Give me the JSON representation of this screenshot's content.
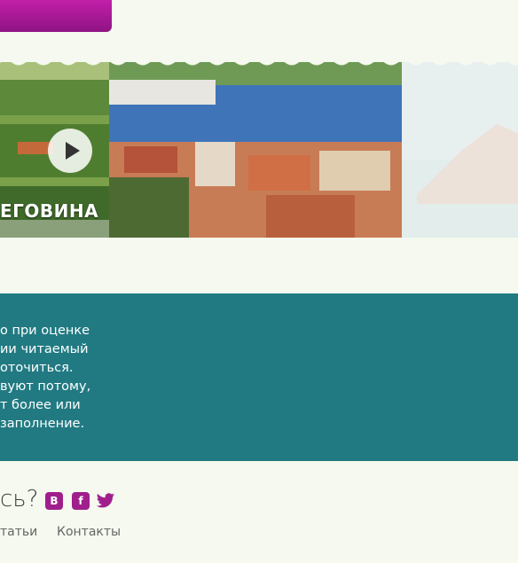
{
  "banner": {
    "region_label": "ЕГОВИНА"
  },
  "info": {
    "lines": [
      "о при оценке",
      "ии читаемый",
      "оточиться.",
      "вуют потому,",
      "т более или",
      "заполнение."
    ]
  },
  "footer": {
    "question": "сь?",
    "social": {
      "vk": "В",
      "facebook": "f",
      "twitter": "twitter-icon"
    },
    "links": [
      "татьи",
      "Контакты"
    ]
  },
  "colors": {
    "accent": "#a01f8c",
    "teal": "#217a82",
    "background": "#f5f9ef"
  }
}
